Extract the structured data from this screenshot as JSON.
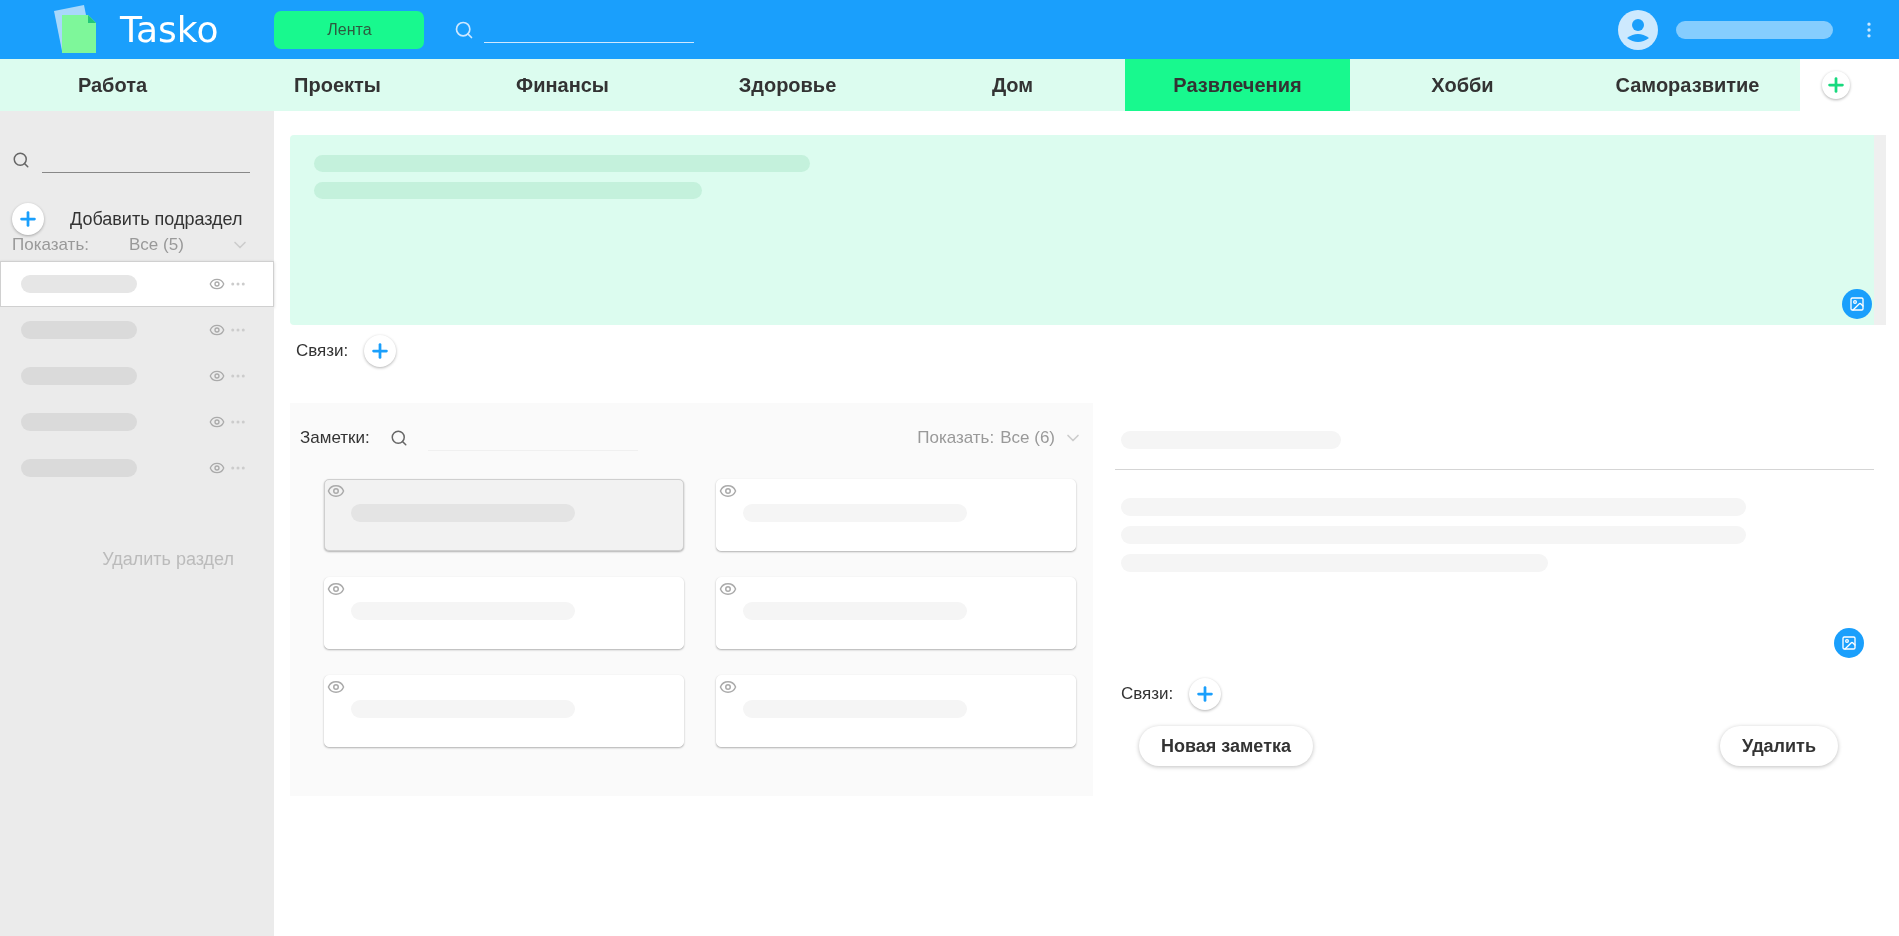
{
  "header": {
    "logo": "Tasko",
    "feed_button": "Лента"
  },
  "tabs": [
    {
      "label": "Работа",
      "selected": false
    },
    {
      "label": "Проекты",
      "selected": false
    },
    {
      "label": "Финансы",
      "selected": false
    },
    {
      "label": "Здоровье",
      "selected": false
    },
    {
      "label": "Дом",
      "selected": false
    },
    {
      "label": "Развлечения",
      "selected": true
    },
    {
      "label": "Хобби",
      "selected": false
    },
    {
      "label": "Саморазвитие",
      "selected": false
    }
  ],
  "sidebar": {
    "add_label": "Добавить подраздел",
    "show_label": "Показать:",
    "show_value": "Все (5)",
    "items": [
      {
        "selected": true
      },
      {
        "selected": false
      },
      {
        "selected": false
      },
      {
        "selected": false
      },
      {
        "selected": false
      }
    ],
    "delete_label": "Удалить раздел"
  },
  "editor": {
    "links_label": "Связи:"
  },
  "notes": {
    "label": "Заметки:",
    "show_label": "Показать:",
    "show_value": "Все (6)",
    "cards": [
      {
        "selected": true
      },
      {
        "selected": false
      },
      {
        "selected": false
      },
      {
        "selected": false
      },
      {
        "selected": false
      },
      {
        "selected": false
      }
    ]
  },
  "detail": {
    "links_label": "Связи:",
    "buttons": [
      "Новая заметка",
      "Удалить"
    ]
  }
}
